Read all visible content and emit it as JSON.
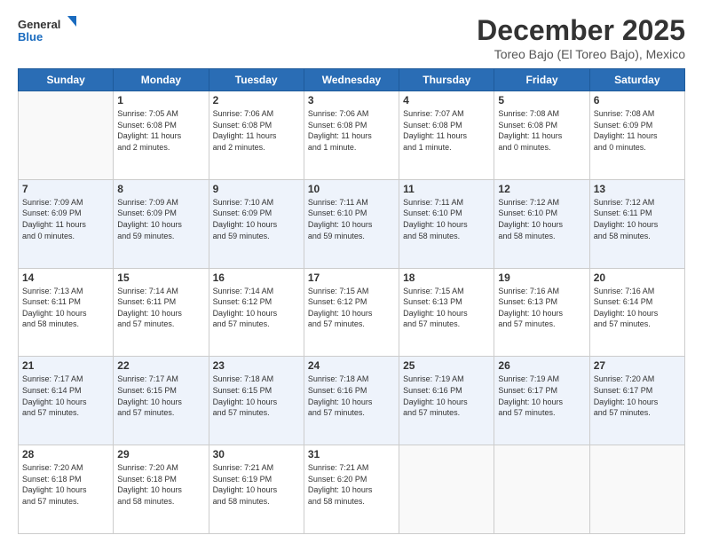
{
  "logo": {
    "text_general": "General",
    "text_blue": "Blue"
  },
  "header": {
    "month_title": "December 2025",
    "subtitle": "Toreo Bajo (El Toreo Bajo), Mexico"
  },
  "weekdays": [
    "Sunday",
    "Monday",
    "Tuesday",
    "Wednesday",
    "Thursday",
    "Friday",
    "Saturday"
  ],
  "weeks": [
    [
      {
        "day": "",
        "info": ""
      },
      {
        "day": "1",
        "info": "Sunrise: 7:05 AM\nSunset: 6:08 PM\nDaylight: 11 hours\nand 2 minutes."
      },
      {
        "day": "2",
        "info": "Sunrise: 7:06 AM\nSunset: 6:08 PM\nDaylight: 11 hours\nand 2 minutes."
      },
      {
        "day": "3",
        "info": "Sunrise: 7:06 AM\nSunset: 6:08 PM\nDaylight: 11 hours\nand 1 minute."
      },
      {
        "day": "4",
        "info": "Sunrise: 7:07 AM\nSunset: 6:08 PM\nDaylight: 11 hours\nand 1 minute."
      },
      {
        "day": "5",
        "info": "Sunrise: 7:08 AM\nSunset: 6:08 PM\nDaylight: 11 hours\nand 0 minutes."
      },
      {
        "day": "6",
        "info": "Sunrise: 7:08 AM\nSunset: 6:09 PM\nDaylight: 11 hours\nand 0 minutes."
      }
    ],
    [
      {
        "day": "7",
        "info": "Sunrise: 7:09 AM\nSunset: 6:09 PM\nDaylight: 11 hours\nand 0 minutes."
      },
      {
        "day": "8",
        "info": "Sunrise: 7:09 AM\nSunset: 6:09 PM\nDaylight: 10 hours\nand 59 minutes."
      },
      {
        "day": "9",
        "info": "Sunrise: 7:10 AM\nSunset: 6:09 PM\nDaylight: 10 hours\nand 59 minutes."
      },
      {
        "day": "10",
        "info": "Sunrise: 7:11 AM\nSunset: 6:10 PM\nDaylight: 10 hours\nand 59 minutes."
      },
      {
        "day": "11",
        "info": "Sunrise: 7:11 AM\nSunset: 6:10 PM\nDaylight: 10 hours\nand 58 minutes."
      },
      {
        "day": "12",
        "info": "Sunrise: 7:12 AM\nSunset: 6:10 PM\nDaylight: 10 hours\nand 58 minutes."
      },
      {
        "day": "13",
        "info": "Sunrise: 7:12 AM\nSunset: 6:11 PM\nDaylight: 10 hours\nand 58 minutes."
      }
    ],
    [
      {
        "day": "14",
        "info": "Sunrise: 7:13 AM\nSunset: 6:11 PM\nDaylight: 10 hours\nand 58 minutes."
      },
      {
        "day": "15",
        "info": "Sunrise: 7:14 AM\nSunset: 6:11 PM\nDaylight: 10 hours\nand 57 minutes."
      },
      {
        "day": "16",
        "info": "Sunrise: 7:14 AM\nSunset: 6:12 PM\nDaylight: 10 hours\nand 57 minutes."
      },
      {
        "day": "17",
        "info": "Sunrise: 7:15 AM\nSunset: 6:12 PM\nDaylight: 10 hours\nand 57 minutes."
      },
      {
        "day": "18",
        "info": "Sunrise: 7:15 AM\nSunset: 6:13 PM\nDaylight: 10 hours\nand 57 minutes."
      },
      {
        "day": "19",
        "info": "Sunrise: 7:16 AM\nSunset: 6:13 PM\nDaylight: 10 hours\nand 57 minutes."
      },
      {
        "day": "20",
        "info": "Sunrise: 7:16 AM\nSunset: 6:14 PM\nDaylight: 10 hours\nand 57 minutes."
      }
    ],
    [
      {
        "day": "21",
        "info": "Sunrise: 7:17 AM\nSunset: 6:14 PM\nDaylight: 10 hours\nand 57 minutes."
      },
      {
        "day": "22",
        "info": "Sunrise: 7:17 AM\nSunset: 6:15 PM\nDaylight: 10 hours\nand 57 minutes."
      },
      {
        "day": "23",
        "info": "Sunrise: 7:18 AM\nSunset: 6:15 PM\nDaylight: 10 hours\nand 57 minutes."
      },
      {
        "day": "24",
        "info": "Sunrise: 7:18 AM\nSunset: 6:16 PM\nDaylight: 10 hours\nand 57 minutes."
      },
      {
        "day": "25",
        "info": "Sunrise: 7:19 AM\nSunset: 6:16 PM\nDaylight: 10 hours\nand 57 minutes."
      },
      {
        "day": "26",
        "info": "Sunrise: 7:19 AM\nSunset: 6:17 PM\nDaylight: 10 hours\nand 57 minutes."
      },
      {
        "day": "27",
        "info": "Sunrise: 7:20 AM\nSunset: 6:17 PM\nDaylight: 10 hours\nand 57 minutes."
      }
    ],
    [
      {
        "day": "28",
        "info": "Sunrise: 7:20 AM\nSunset: 6:18 PM\nDaylight: 10 hours\nand 57 minutes."
      },
      {
        "day": "29",
        "info": "Sunrise: 7:20 AM\nSunset: 6:18 PM\nDaylight: 10 hours\nand 58 minutes."
      },
      {
        "day": "30",
        "info": "Sunrise: 7:21 AM\nSunset: 6:19 PM\nDaylight: 10 hours\nand 58 minutes."
      },
      {
        "day": "31",
        "info": "Sunrise: 7:21 AM\nSunset: 6:20 PM\nDaylight: 10 hours\nand 58 minutes."
      },
      {
        "day": "",
        "info": ""
      },
      {
        "day": "",
        "info": ""
      },
      {
        "day": "",
        "info": ""
      }
    ]
  ]
}
